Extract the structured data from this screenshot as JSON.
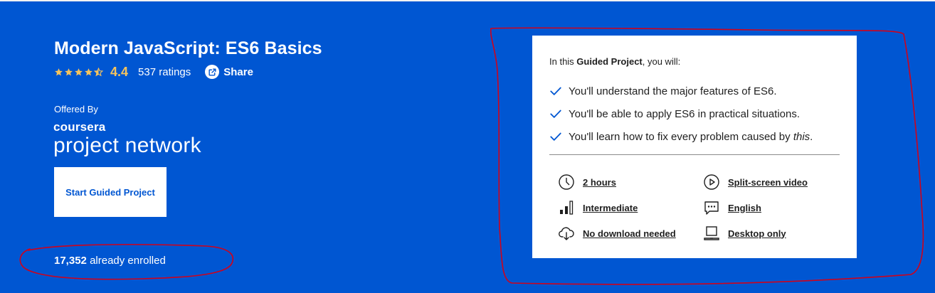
{
  "course": {
    "title": "Modern JavaScript: ES6 Basics",
    "rating_value": "4.4",
    "stars_filled": 4.4,
    "ratings_count": "537 ratings",
    "share_label": "Share",
    "offered_by_label": "Offered By",
    "provider_brand": "coursera",
    "provider_sub": "project network",
    "start_button": "Start Guided Project",
    "enrolled_count": "17,352",
    "enrolled_suffix": "already enrolled"
  },
  "card": {
    "intro_prefix": "In this ",
    "intro_bold": "Guided Project",
    "intro_suffix": ", you will:",
    "outcomes": [
      {
        "text": "You'll understand the major features of ES6."
      },
      {
        "text": "You'll be able to apply ES6 in practical situations."
      },
      {
        "text": "You'll learn how to fix every problem caused by ",
        "italic": "this",
        "after": "."
      }
    ],
    "features": [
      {
        "label": "2 hours",
        "icon": "clock-icon"
      },
      {
        "label": "Split-screen video",
        "icon": "play-icon"
      },
      {
        "label": "Intermediate",
        "icon": "level-bars-icon"
      },
      {
        "label": "English",
        "icon": "chat-bubble-icon"
      },
      {
        "label": "No download needed",
        "icon": "cloud-download-icon"
      },
      {
        "label": "Desktop only",
        "icon": "laptop-icon"
      }
    ]
  },
  "colors": {
    "background": "#0056d2",
    "star": "#f5c45e",
    "check": "#0056d2",
    "annotation": "#d0021b"
  }
}
